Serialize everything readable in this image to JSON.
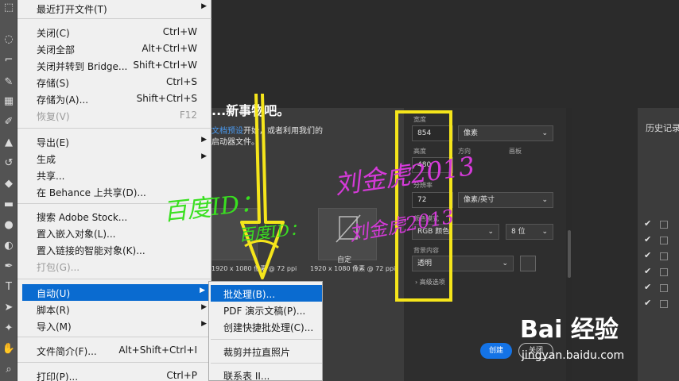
{
  "menu": {
    "items": [
      {
        "label": "最近打开文件(T)",
        "shortcut": "",
        "arrow": "▶"
      },
      {
        "label": "关闭(C)",
        "shortcut": "Ctrl+W",
        "arrow": ""
      },
      {
        "label": "关闭全部",
        "shortcut": "Alt+Ctrl+W",
        "arrow": ""
      },
      {
        "label": "关闭并转到 Bridge...",
        "shortcut": "Shift+Ctrl+W",
        "arrow": ""
      },
      {
        "label": "存储(S)",
        "shortcut": "Ctrl+S",
        "arrow": ""
      },
      {
        "label": "存储为(A)...",
        "shortcut": "Shift+Ctrl+S",
        "arrow": ""
      },
      {
        "label": "恢复(V)",
        "shortcut": "F12",
        "arrow": ""
      },
      {
        "label": "导出(E)",
        "shortcut": "",
        "arrow": "▶"
      },
      {
        "label": "生成",
        "shortcut": "",
        "arrow": "▶"
      },
      {
        "label": "共享...",
        "shortcut": "",
        "arrow": ""
      },
      {
        "label": "在 Behance 上共享(D)...",
        "shortcut": "",
        "arrow": ""
      },
      {
        "label": "搜索 Adobe Stock...",
        "shortcut": "",
        "arrow": ""
      },
      {
        "label": "置入嵌入对象(L)...",
        "shortcut": "",
        "arrow": ""
      },
      {
        "label": "置入链接的智能对象(K)...",
        "shortcut": "",
        "arrow": ""
      },
      {
        "label": "打包(G)...",
        "shortcut": "",
        "arrow": ""
      },
      {
        "label": "自动(U)",
        "shortcut": "",
        "arrow": "▶"
      },
      {
        "label": "脚本(R)",
        "shortcut": "",
        "arrow": "▶"
      },
      {
        "label": "导入(M)",
        "shortcut": "",
        "arrow": "▶"
      },
      {
        "label": "文件简介(F)...",
        "shortcut": "Alt+Shift+Ctrl+I",
        "arrow": ""
      },
      {
        "label": "打印(P)...",
        "shortcut": "Ctrl+P",
        "arrow": ""
      }
    ]
  },
  "submenu": {
    "items": [
      {
        "label": "批处理(B)..."
      },
      {
        "label": "PDF 演示文稿(P)..."
      },
      {
        "label": "创建快捷批处理(C)..."
      },
      {
        "label": "裁剪并拉直照片"
      },
      {
        "label": "联系表 II..."
      }
    ]
  },
  "dialog": {
    "welcome": "...新事物吧。",
    "desc_line1_link": "文档预设",
    "desc_line1_rest": "开始，或者利用我们的",
    "desc_line2": "启动器文件。",
    "thumb_caption_left": "1920 x 1080 像素 @ 72 ppi",
    "thumb_custom_label": "自定",
    "thumb_caption_right": "1920 x 1080 像素 @ 72 ppi",
    "width_label": "宽度",
    "width_value": "854",
    "width_unit": "像素",
    "height_label": "高度",
    "height_value": "480",
    "orientation_label": "方向",
    "artboard_label": "画板",
    "resolution_label": "分辨率",
    "resolution_value": "72",
    "resolution_unit": "像素/英寸",
    "color_mode_label": "颜色模式",
    "color_mode_value": "RGB 颜色",
    "bit_depth": "8 位",
    "background_label": "背景内容",
    "background_value": "透明",
    "advanced_label": "高级选项",
    "create_button": "创建",
    "close_button": "关闭"
  },
  "history": {
    "tab": "历史记录"
  },
  "watermarks": {
    "large_green": "百度ID：",
    "large_pink": "刘金虎2013",
    "small_green": "百度ID：",
    "small_pink": "刘金虎2013"
  },
  "logo": {
    "main": "Bai 经验",
    "url": "jingyan.baidu.com"
  },
  "colors": {
    "menu_highlight": "#0a6bd0",
    "annotation_yellow": "#f5e51b",
    "create_button": "#1473e6"
  }
}
